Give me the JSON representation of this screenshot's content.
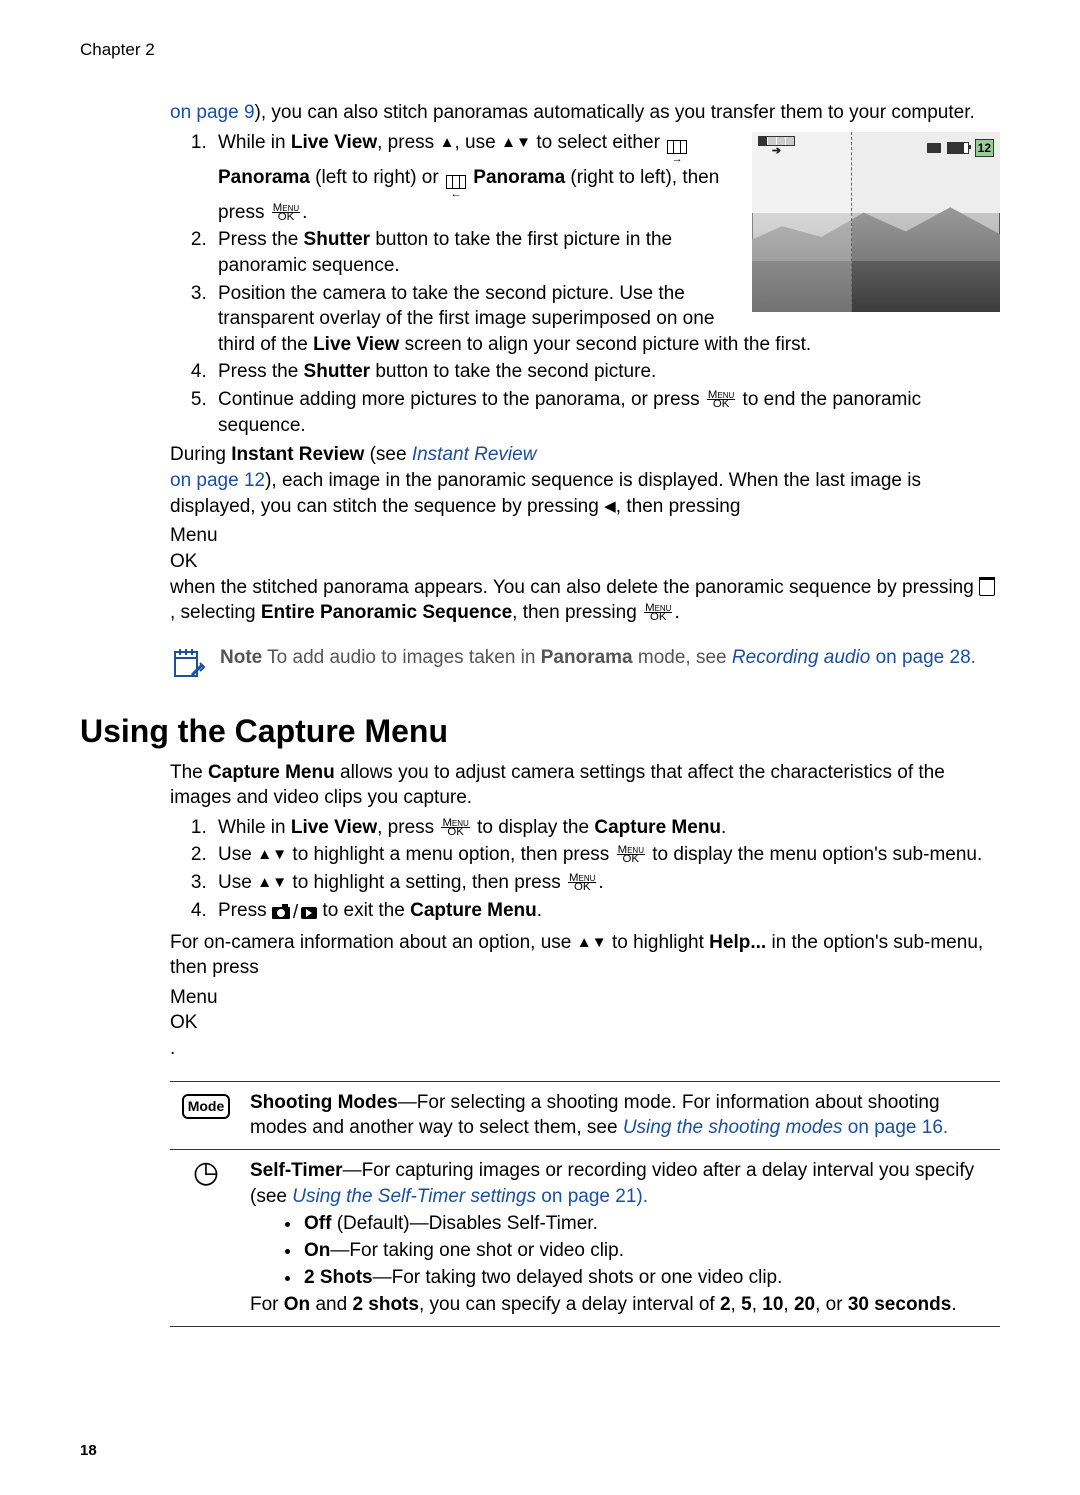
{
  "chapter": "Chapter 2",
  "continuation": {
    "link": "on page 9",
    "rest": "), you can also stitch panoramas automatically as you transfer them to your computer."
  },
  "steps_a": {
    "s1_a": "While in ",
    "s1_b": "Live View",
    "s1_c": ", press ",
    "s1_d": ", use ",
    "s1_e": " to select either ",
    "s1_f": "Panorama",
    "s1_g": " (left to right) or ",
    "s1_h": "Panorama",
    "s1_i": " (right to left), then press ",
    "s2_a": "Press the ",
    "s2_b": "Shutter",
    "s2_c": " button to take the first picture in the panoramic sequence.",
    "s3_a": "Position the camera to take the second picture. Use the transparent overlay of the first image superimposed on one third of the ",
    "s3_b": "Live View",
    "s3_c": " screen to align your second picture with the first.",
    "s4_a": "Press the ",
    "s4_b": "Shutter",
    "s4_c": " button to take the second picture.",
    "s5_a": "Continue adding more pictures to the panorama, or press ",
    "s5_b": " to end the panoramic sequence."
  },
  "instant_review": {
    "a": "During ",
    "b": "Instant Review",
    "c": " (see ",
    "link1": "Instant Review",
    "link2": "on page 12",
    "d": "), each image in the panoramic sequence is displayed. When the last image is displayed, you can stitch the sequence by pressing ",
    "e": ", then pressing ",
    "f": " when the stitched panorama appears. You can also delete the panoramic sequence by pressing ",
    "g": ", selecting ",
    "h": "Entire Panoramic Sequence",
    "i": ", then pressing "
  },
  "note": {
    "label": "Note",
    "a": "  To add audio to images taken in ",
    "b": "Panorama",
    "c": " mode, see ",
    "link": "Recording audio",
    "link2": "on page 28",
    "end": "."
  },
  "h2": "Using the Capture Menu",
  "capture_intro_a": "The ",
  "capture_intro_b": "Capture Menu",
  "capture_intro_c": " allows you to adjust camera settings that affect the characteristics of the images and video clips you capture.",
  "steps_b": {
    "s1_a": "While in ",
    "s1_b": "Live View",
    "s1_c": ", press ",
    "s1_d": " to display the ",
    "s1_e": "Capture Menu",
    "s1_f": ".",
    "s2_a": "Use ",
    "s2_b": " to highlight a menu option, then press ",
    "s2_c": " to display the menu option's sub-menu.",
    "s3_a": "Use ",
    "s3_b": " to highlight a setting, then press ",
    "s3_c": ".",
    "s4_a": "Press ",
    "s4_b": " to exit the ",
    "s4_c": "Capture Menu",
    "s4_d": "."
  },
  "help_line_a": "For on-camera information about an option, use ",
  "help_line_b": " to highlight ",
  "help_line_c": "Help...",
  "help_line_d": " in the option's sub-menu, then press ",
  "table": {
    "mode_label": "Mode",
    "r1_a": "Shooting Modes",
    "r1_b": "—For selecting a shooting mode. For information about shooting modes and another way to select them, see ",
    "r1_link": "Using the shooting modes",
    "r1_c": " on page 16.",
    "r2_a": "Self-Timer",
    "r2_b": "—For capturing images or recording video after a delay interval you specify (see ",
    "r2_link": "Using the Self-Timer settings",
    "r2_c": " on page 21).",
    "r2_off_a": "Off",
    "r2_off_b": " (Default)—Disables Self-Timer.",
    "r2_on_a": "On",
    "r2_on_b": "—For taking one shot or video clip.",
    "r2_2s_a": "2 Shots",
    "r2_2s_b": "—For taking two delayed shots or one video clip.",
    "r2_foot_a": "For ",
    "r2_foot_b": "On",
    "r2_foot_c": " and ",
    "r2_foot_d": "2 shots",
    "r2_foot_e": ", you can specify a delay interval of ",
    "r2_foot_f": "2",
    "r2_foot_g": ", ",
    "r2_foot_h": "5",
    "r2_foot_i": ", ",
    "r2_foot_j": "10",
    "r2_foot_k": ", ",
    "r2_foot_l": "20",
    "r2_foot_m": ", or ",
    "r2_foot_n": "30 seconds",
    "r2_foot_o": "."
  },
  "photo_hud": {
    "count": "12"
  },
  "page_number": "18",
  "menuok": {
    "top": "Menu",
    "bot": "OK"
  }
}
